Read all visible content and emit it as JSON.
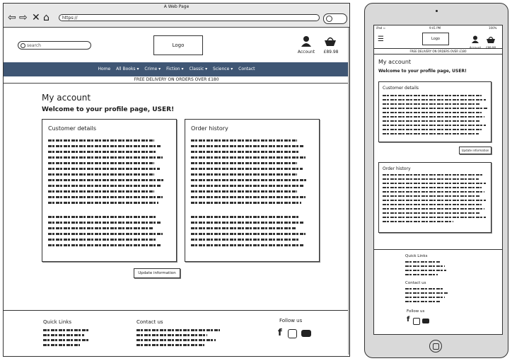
{
  "browser": {
    "window_title": "A Web Page",
    "url": "https://"
  },
  "header": {
    "search_placeholder": "search",
    "logo": "Logo",
    "account_label": "Account",
    "bag_label": "£89.98"
  },
  "nav": [
    "Home",
    "All Books ▾",
    "Crime ▾",
    "Fiction ▾",
    "Classic ▾",
    "Science ▾",
    "Contact"
  ],
  "delivery_banner": "FREE DELIVERY ON ORDERS OVER £180",
  "main": {
    "title": "My account",
    "welcome": "Welcome to your profile page, USER!",
    "customer_details_title": "Customer details",
    "order_history_title": "Order history",
    "update_button": "Update information"
  },
  "footer": {
    "quick_links": "Quick Links",
    "contact_us": "Contact us",
    "follow_us": "Follow us"
  },
  "phone": {
    "status_left": "iPad ≈",
    "status_center": "9:41 PM",
    "status_right": "100%",
    "logo": "Logo",
    "account_label": "Account",
    "bag_label": "£89.98",
    "delivery_banner": "FREE DELIVERY ON ORDERS OVER £180",
    "title": "My account",
    "welcome": "Welcome to your profile page, USER!",
    "customer_details_title": "Customer details",
    "order_history_title": "Order history",
    "update_button": "Update information",
    "quick_links": "Quick Links",
    "contact_us": "Contact us",
    "follow_us": "Follow us"
  },
  "colors": {
    "nav_bg": "#3f5674",
    "outline": "#333333"
  },
  "icons": [
    "back-arrow-icon",
    "forward-arrow-icon",
    "close-icon",
    "home-icon",
    "search-icon",
    "account-icon",
    "basket-icon",
    "facebook-icon",
    "instagram-icon",
    "youtube-icon",
    "hamburger-icon"
  ]
}
